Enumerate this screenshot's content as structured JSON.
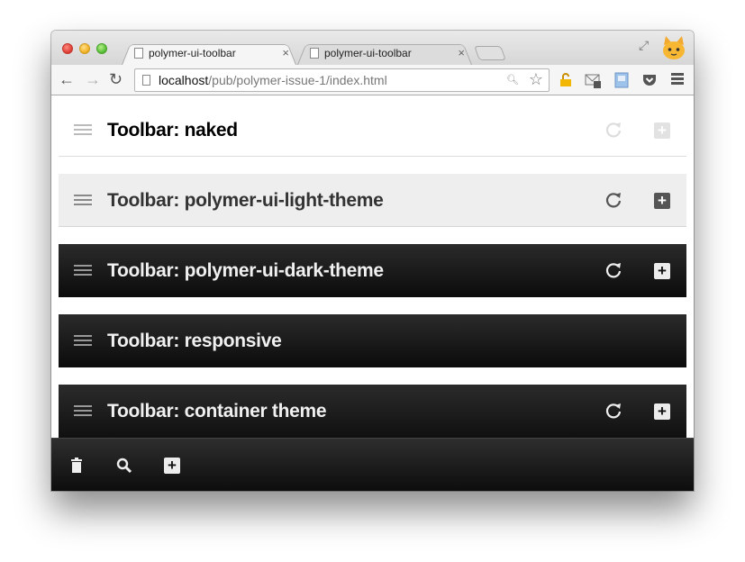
{
  "browser": {
    "tabs": [
      {
        "title": "polymer-ui-toolbar",
        "active": true,
        "close": "×"
      },
      {
        "title": "polymer-ui-toolbar",
        "active": false,
        "close": "×"
      }
    ],
    "url_host": "localhost",
    "url_path": "/pub/polymer-issue-1/index.html",
    "nav": {
      "back": "←",
      "forward": "→",
      "reload": "↻"
    },
    "extensions": [
      "lock-extension-icon",
      "mail-extension-icon",
      "note-extension-icon",
      "pocket-icon"
    ]
  },
  "toolbars": [
    {
      "title": "Toolbar: naked",
      "theme": "naked",
      "has_actions": true
    },
    {
      "title": "Toolbar: polymer-ui-light-theme",
      "theme": "light",
      "has_actions": true
    },
    {
      "title": "Toolbar: polymer-ui-dark-theme",
      "theme": "dark",
      "has_actions": true
    },
    {
      "title": "Toolbar: responsive",
      "theme": "dark",
      "has_actions": false
    },
    {
      "title": "Toolbar: container theme",
      "theme": "dark",
      "has_actions": true
    }
  ],
  "add_symbol": "+",
  "bottom_bar": {
    "icons": [
      "trash-icon",
      "search-icon",
      "add-icon"
    ]
  },
  "colors": {
    "dark_bar": "#141414",
    "light_bar": "#eeeeee",
    "accent_add": "#ececec"
  }
}
